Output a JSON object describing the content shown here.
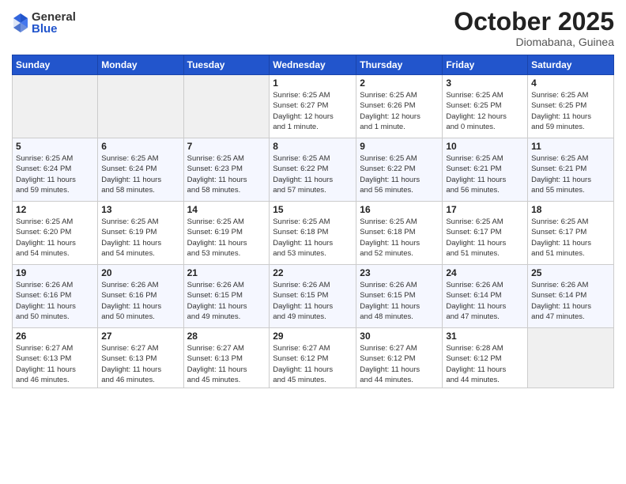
{
  "header": {
    "logo_general": "General",
    "logo_blue": "Blue",
    "month_title": "October 2025",
    "location": "Diomabana, Guinea"
  },
  "days_of_week": [
    "Sunday",
    "Monday",
    "Tuesday",
    "Wednesday",
    "Thursday",
    "Friday",
    "Saturday"
  ],
  "weeks": [
    [
      {
        "day": "",
        "info": ""
      },
      {
        "day": "",
        "info": ""
      },
      {
        "day": "",
        "info": ""
      },
      {
        "day": "1",
        "info": "Sunrise: 6:25 AM\nSunset: 6:27 PM\nDaylight: 12 hours\nand 1 minute."
      },
      {
        "day": "2",
        "info": "Sunrise: 6:25 AM\nSunset: 6:26 PM\nDaylight: 12 hours\nand 1 minute."
      },
      {
        "day": "3",
        "info": "Sunrise: 6:25 AM\nSunset: 6:25 PM\nDaylight: 12 hours\nand 0 minutes."
      },
      {
        "day": "4",
        "info": "Sunrise: 6:25 AM\nSunset: 6:25 PM\nDaylight: 11 hours\nand 59 minutes."
      }
    ],
    [
      {
        "day": "5",
        "info": "Sunrise: 6:25 AM\nSunset: 6:24 PM\nDaylight: 11 hours\nand 59 minutes."
      },
      {
        "day": "6",
        "info": "Sunrise: 6:25 AM\nSunset: 6:24 PM\nDaylight: 11 hours\nand 58 minutes."
      },
      {
        "day": "7",
        "info": "Sunrise: 6:25 AM\nSunset: 6:23 PM\nDaylight: 11 hours\nand 58 minutes."
      },
      {
        "day": "8",
        "info": "Sunrise: 6:25 AM\nSunset: 6:22 PM\nDaylight: 11 hours\nand 57 minutes."
      },
      {
        "day": "9",
        "info": "Sunrise: 6:25 AM\nSunset: 6:22 PM\nDaylight: 11 hours\nand 56 minutes."
      },
      {
        "day": "10",
        "info": "Sunrise: 6:25 AM\nSunset: 6:21 PM\nDaylight: 11 hours\nand 56 minutes."
      },
      {
        "day": "11",
        "info": "Sunrise: 6:25 AM\nSunset: 6:21 PM\nDaylight: 11 hours\nand 55 minutes."
      }
    ],
    [
      {
        "day": "12",
        "info": "Sunrise: 6:25 AM\nSunset: 6:20 PM\nDaylight: 11 hours\nand 54 minutes."
      },
      {
        "day": "13",
        "info": "Sunrise: 6:25 AM\nSunset: 6:19 PM\nDaylight: 11 hours\nand 54 minutes."
      },
      {
        "day": "14",
        "info": "Sunrise: 6:25 AM\nSunset: 6:19 PM\nDaylight: 11 hours\nand 53 minutes."
      },
      {
        "day": "15",
        "info": "Sunrise: 6:25 AM\nSunset: 6:18 PM\nDaylight: 11 hours\nand 53 minutes."
      },
      {
        "day": "16",
        "info": "Sunrise: 6:25 AM\nSunset: 6:18 PM\nDaylight: 11 hours\nand 52 minutes."
      },
      {
        "day": "17",
        "info": "Sunrise: 6:25 AM\nSunset: 6:17 PM\nDaylight: 11 hours\nand 51 minutes."
      },
      {
        "day": "18",
        "info": "Sunrise: 6:25 AM\nSunset: 6:17 PM\nDaylight: 11 hours\nand 51 minutes."
      }
    ],
    [
      {
        "day": "19",
        "info": "Sunrise: 6:26 AM\nSunset: 6:16 PM\nDaylight: 11 hours\nand 50 minutes."
      },
      {
        "day": "20",
        "info": "Sunrise: 6:26 AM\nSunset: 6:16 PM\nDaylight: 11 hours\nand 50 minutes."
      },
      {
        "day": "21",
        "info": "Sunrise: 6:26 AM\nSunset: 6:15 PM\nDaylight: 11 hours\nand 49 minutes."
      },
      {
        "day": "22",
        "info": "Sunrise: 6:26 AM\nSunset: 6:15 PM\nDaylight: 11 hours\nand 49 minutes."
      },
      {
        "day": "23",
        "info": "Sunrise: 6:26 AM\nSunset: 6:15 PM\nDaylight: 11 hours\nand 48 minutes."
      },
      {
        "day": "24",
        "info": "Sunrise: 6:26 AM\nSunset: 6:14 PM\nDaylight: 11 hours\nand 47 minutes."
      },
      {
        "day": "25",
        "info": "Sunrise: 6:26 AM\nSunset: 6:14 PM\nDaylight: 11 hours\nand 47 minutes."
      }
    ],
    [
      {
        "day": "26",
        "info": "Sunrise: 6:27 AM\nSunset: 6:13 PM\nDaylight: 11 hours\nand 46 minutes."
      },
      {
        "day": "27",
        "info": "Sunrise: 6:27 AM\nSunset: 6:13 PM\nDaylight: 11 hours\nand 46 minutes."
      },
      {
        "day": "28",
        "info": "Sunrise: 6:27 AM\nSunset: 6:13 PM\nDaylight: 11 hours\nand 45 minutes."
      },
      {
        "day": "29",
        "info": "Sunrise: 6:27 AM\nSunset: 6:12 PM\nDaylight: 11 hours\nand 45 minutes."
      },
      {
        "day": "30",
        "info": "Sunrise: 6:27 AM\nSunset: 6:12 PM\nDaylight: 11 hours\nand 44 minutes."
      },
      {
        "day": "31",
        "info": "Sunrise: 6:28 AM\nSunset: 6:12 PM\nDaylight: 11 hours\nand 44 minutes."
      },
      {
        "day": "",
        "info": ""
      }
    ]
  ]
}
